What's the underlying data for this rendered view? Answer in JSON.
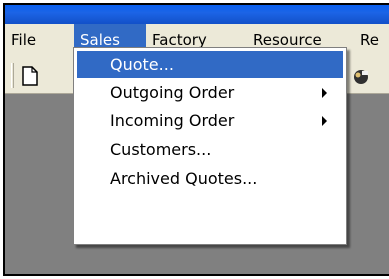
{
  "menubar": {
    "items": [
      {
        "label": "File"
      },
      {
        "label": "Sales"
      },
      {
        "label": "Factory"
      },
      {
        "label": "Resource"
      },
      {
        "label": "Re"
      }
    ]
  },
  "toolbar": {
    "icons": [
      "new-document-icon",
      "app-icon"
    ]
  },
  "sales_menu": {
    "items": [
      {
        "label": "Quote...",
        "selected": true,
        "submenu": false
      },
      {
        "label": "Outgoing Order",
        "selected": false,
        "submenu": true
      },
      {
        "label": "Incoming Order",
        "selected": false,
        "submenu": true
      },
      {
        "label": "Customers...",
        "selected": false,
        "submenu": false
      },
      {
        "label": "Archived Quotes...",
        "selected": false,
        "submenu": false
      }
    ]
  },
  "colors": {
    "selection": "#316ac5",
    "menubar": "#ece9d8",
    "workspace": "#808080"
  }
}
